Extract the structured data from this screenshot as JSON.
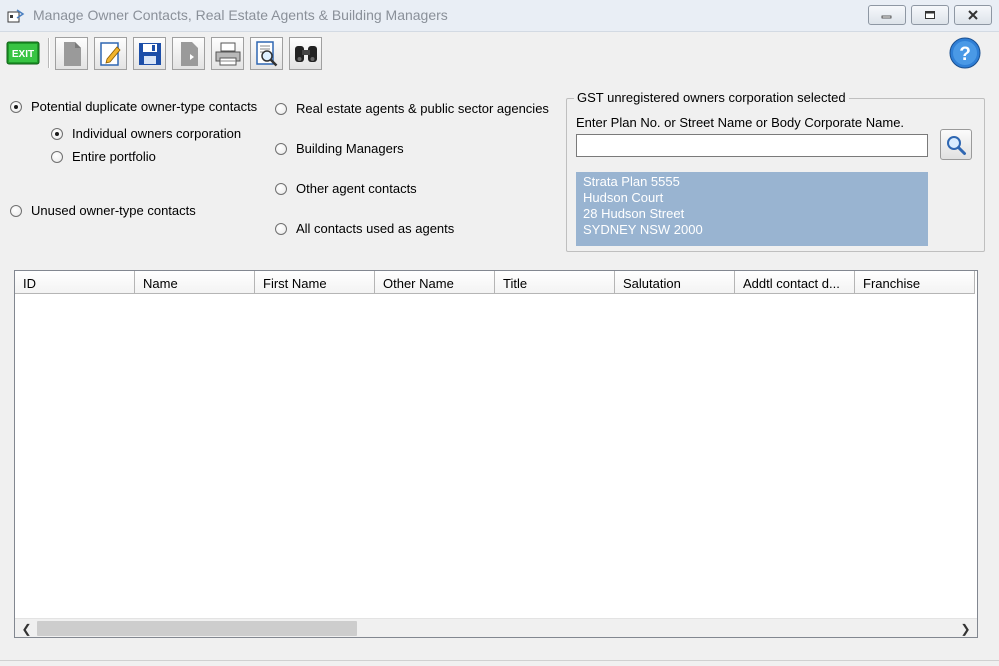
{
  "window": {
    "title": "Manage Owner Contacts, Real Estate Agents & Building Managers",
    "controls": [
      "minimize",
      "maximize",
      "close"
    ]
  },
  "toolbar": {
    "exit_label": "EXIT",
    "buttons": [
      "exit-icon",
      "new-document-icon",
      "edit-icon",
      "save-icon",
      "export-icon",
      "print-icon",
      "print-preview-icon",
      "find-icon",
      "help-icon"
    ],
    "help_label": "?"
  },
  "options": {
    "potential_duplicates": {
      "label": "Potential duplicate owner-type contacts",
      "checked": true
    },
    "individual_oc": {
      "label": "Individual owners corporation",
      "checked": true
    },
    "entire_portfolio": {
      "label": "Entire portfolio",
      "checked": false
    },
    "unused_owner": {
      "label": "Unused owner-type contacts",
      "checked": false
    },
    "real_estate_agents": {
      "label": "Real estate agents & public sector agencies",
      "checked": false
    },
    "building_managers": {
      "label": "Building Managers",
      "checked": false
    },
    "other_agent": {
      "label": "Other agent contacts",
      "checked": false
    },
    "all_agents": {
      "label": "All contacts used as agents",
      "checked": false
    }
  },
  "gst": {
    "legend": "GST unregistered owners corporation selected",
    "prompt": "Enter Plan No. or Street Name or Body Corporate Name.",
    "search_value": "",
    "address_lines": [
      "Strata Plan 5555",
      "Hudson Court",
      "28 Hudson Street",
      "SYDNEY  NSW  2000"
    ]
  },
  "grid": {
    "columns": [
      "ID",
      "Name",
      "First Name",
      "Other Name",
      "Title",
      "Salutation",
      "Addtl contact d...",
      "Franchise"
    ],
    "rows": []
  },
  "colors": {
    "address_bg": "#99b4d1",
    "window_bg": "#f0f0f0"
  }
}
